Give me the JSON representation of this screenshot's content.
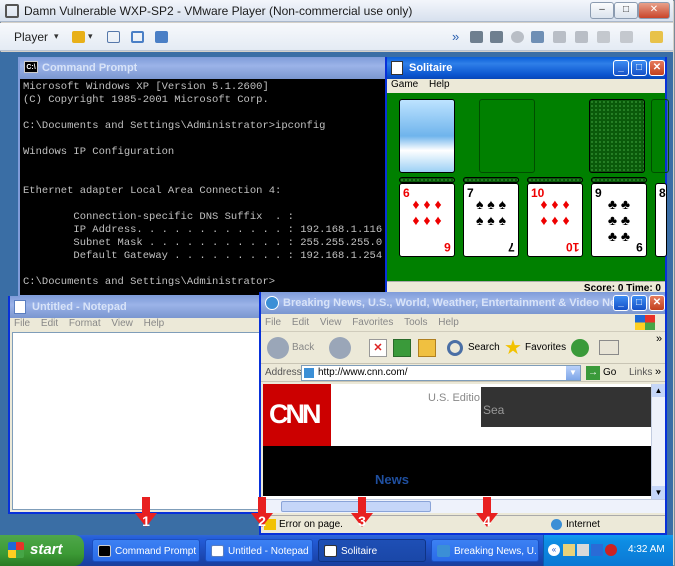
{
  "vmware": {
    "title": "Damn Vulnerable WXP-SP2 - VMware Player (Non-commercial use only)",
    "player_menu": "Player"
  },
  "cmd": {
    "title": "Command Prompt",
    "icon_label": "C:\\",
    "lines": [
      "Microsoft Windows XP [Version 5.1.2600]",
      "(C) Copyright 1985-2001 Microsoft Corp.",
      "",
      "C:\\Documents and Settings\\Administrator>ipconfig",
      "",
      "Windows IP Configuration",
      "",
      "",
      "Ethernet adapter Local Area Connection 4:",
      "",
      "        Connection-specific DNS Suffix  . :",
      "        IP Address. . . . . . . . . . . . : 192.168.1.116",
      "        Subnet Mask . . . . . . . . . . . : 255.255.255.0",
      "        Default Gateway . . . . . . . . . : 192.168.1.254",
      "",
      "C:\\Documents and Settings\\Administrator>"
    ]
  },
  "solitaire": {
    "title": "Solitaire",
    "menu": [
      "Game",
      "Help"
    ],
    "status": "Score: 0 Time: 0",
    "cards": [
      {
        "rank": "6",
        "suit": "♦",
        "color": "red"
      },
      {
        "rank": "7",
        "suit": "♠",
        "color": "blk"
      },
      {
        "rank": "10",
        "suit": "♦",
        "color": "red"
      },
      {
        "rank": "9",
        "suit": "♣",
        "color": "blk"
      },
      {
        "rank": "8",
        "suit": "♣",
        "color": "blk"
      }
    ]
  },
  "notepad": {
    "title": "Untitled - Notepad",
    "menu": [
      "File",
      "Edit",
      "Format",
      "View",
      "Help"
    ]
  },
  "ie": {
    "title": "Breaking News, U.S., World, Weather, Entertainment & Video Ne...",
    "menu": [
      "File",
      "Edit",
      "View",
      "Favorites",
      "Tools",
      "Help"
    ],
    "back": "Back",
    "search": "Search",
    "favorites": "Favorites",
    "address_label": "Address",
    "url": "http://www.cnn.com/",
    "go": "Go",
    "links": "Links",
    "cnn_logo": "CNN",
    "edition": "U.S. Editio",
    "search_box": "Sea",
    "news_label": "News",
    "status_left": "Error on page.",
    "status_right": "Internet"
  },
  "taskbar": {
    "start": "start",
    "tasks": [
      "Command Prompt",
      "Untitled - Notepad",
      "Solitaire",
      "Breaking News, U...."
    ],
    "clock": "4:32 AM"
  },
  "annotations": [
    "1",
    "2",
    "3",
    "4"
  ],
  "colors": {
    "xp_blue": "#0a5fd9",
    "felt_green": "#008000",
    "arrow_red": "#e82020",
    "cnn_red": "#cc0000"
  }
}
